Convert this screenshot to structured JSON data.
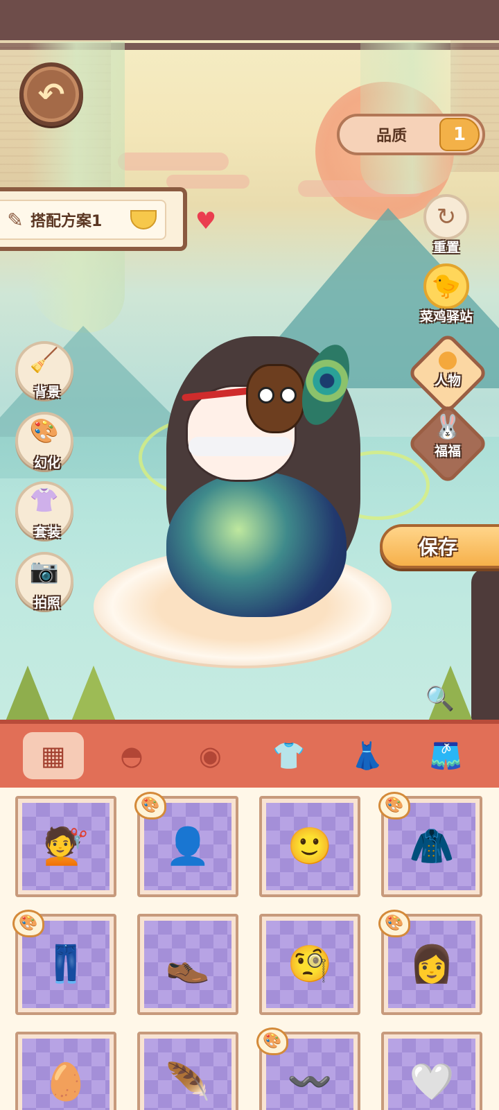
{
  "header": {
    "back_icon": "back-arrow-icon",
    "quality_label": "品质",
    "quality_toggle_icon": "toggle-1-icon"
  },
  "outfit_plan": {
    "name": "搭配方案1",
    "icon": "edit-document-icon",
    "favorited": true
  },
  "left_menu": [
    {
      "label": "背景",
      "icon": "broom-icon"
    },
    {
      "label": "幻化",
      "icon": "palette-icon"
    },
    {
      "label": "套装",
      "icon": "hanger-icon"
    },
    {
      "label": "拍照",
      "icon": "camera-icon"
    }
  ],
  "right_menu": {
    "reset_label": "重置",
    "station_label": "菜鸡驿站",
    "character_label": "人物",
    "fufu_label": "福福",
    "save_label": "保存"
  },
  "category_tabs": [
    {
      "name": "all",
      "icon": "grid-icon",
      "active": true
    },
    {
      "name": "hair",
      "icon": "hair-icon",
      "active": false
    },
    {
      "name": "eyes",
      "icon": "eye-icon",
      "active": false
    },
    {
      "name": "top",
      "icon": "shirt-icon",
      "active": false
    },
    {
      "name": "dress",
      "icon": "dress-icon",
      "active": false
    },
    {
      "name": "pants",
      "icon": "shorts-icon",
      "active": false
    }
  ],
  "items": [
    {
      "type": "ponytail-hair",
      "thumb": "💇",
      "dyeable": false
    },
    {
      "type": "short-hair",
      "thumb": "👤",
      "dyeable": true
    },
    {
      "type": "face",
      "thumb": "🙂",
      "dyeable": false
    },
    {
      "type": "black-coat",
      "thumb": "🧥",
      "dyeable": true
    },
    {
      "type": "black-pants",
      "thumb": "👖",
      "dyeable": true
    },
    {
      "type": "black-shoes",
      "thumb": "👞",
      "dyeable": false
    },
    {
      "type": "monocle",
      "thumb": "🧐",
      "dyeable": false
    },
    {
      "type": "curly-hair",
      "thumb": "👩",
      "dyeable": true
    },
    {
      "type": "bald-head",
      "thumb": "🥚",
      "dyeable": false
    },
    {
      "type": "feather-headpiece",
      "thumb": "🪶",
      "dyeable": false
    },
    {
      "type": "eyebrows",
      "thumb": "〰️",
      "dyeable": true
    },
    {
      "type": "fur-collar",
      "thumb": "🤍",
      "dyeable": false
    }
  ],
  "colors": {
    "category_bar": "#e16f57",
    "accent_gold": "#f6b04a",
    "panel_brown": "#8a5a40",
    "grid_purple": "#b7a3e4"
  }
}
